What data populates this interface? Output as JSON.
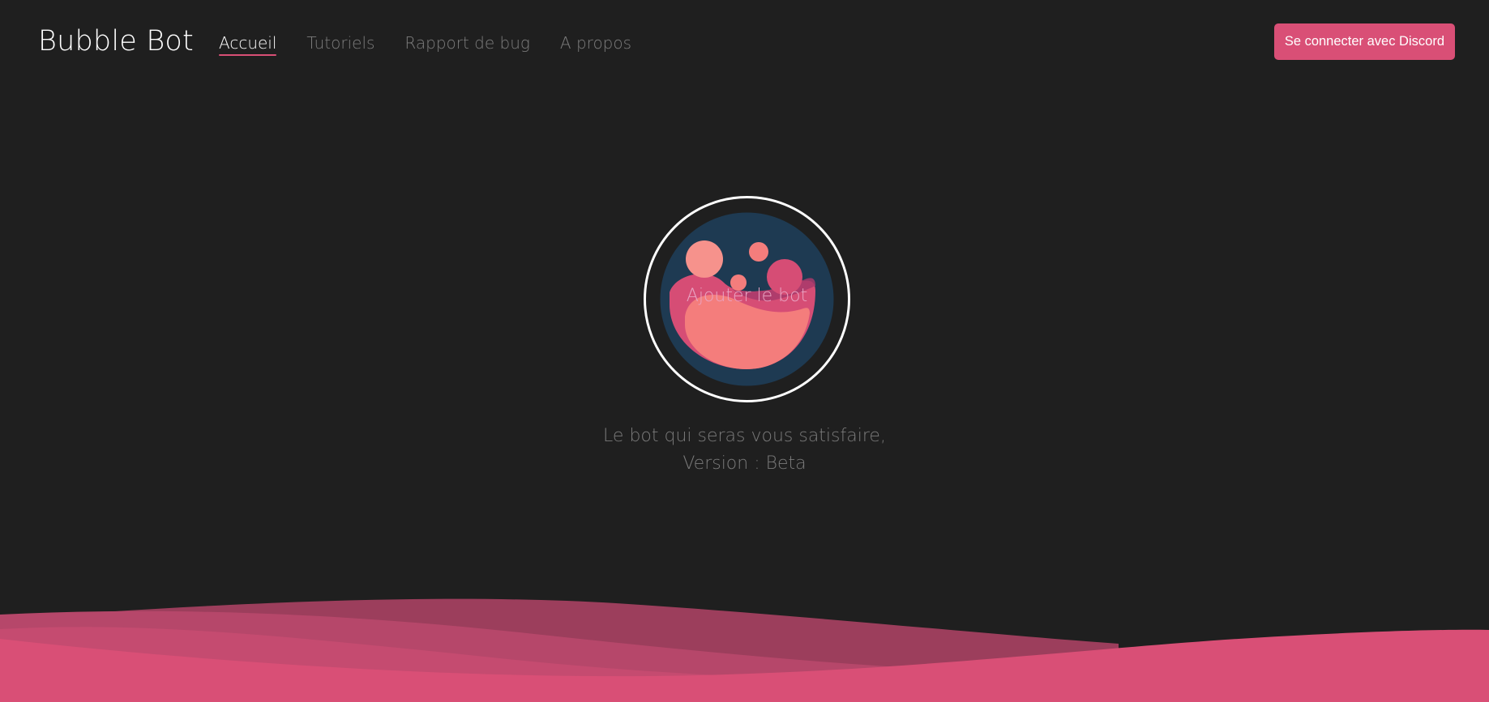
{
  "brand": {
    "name": "Bubble Bot"
  },
  "nav": {
    "items": [
      {
        "label": "Accueil",
        "active": true
      },
      {
        "label": "Tutoriels",
        "active": false
      },
      {
        "label": "Rapport de bug",
        "active": false
      },
      {
        "label": "A propos",
        "active": false
      }
    ]
  },
  "header": {
    "login_label": "Se connecter avec Discord"
  },
  "hero": {
    "add_bot_label": "Ajouter le bot",
    "logo_icon": "bubble-bot-logo-icon"
  },
  "tagline": {
    "line1": "Le bot qui seras vous satisfaire,",
    "line2": "Version : Beta"
  },
  "colors": {
    "background": "#1f1f1f",
    "accent": "#d94f76",
    "logo_bg": "#1e3a52",
    "salmon": "#f47d7c"
  }
}
